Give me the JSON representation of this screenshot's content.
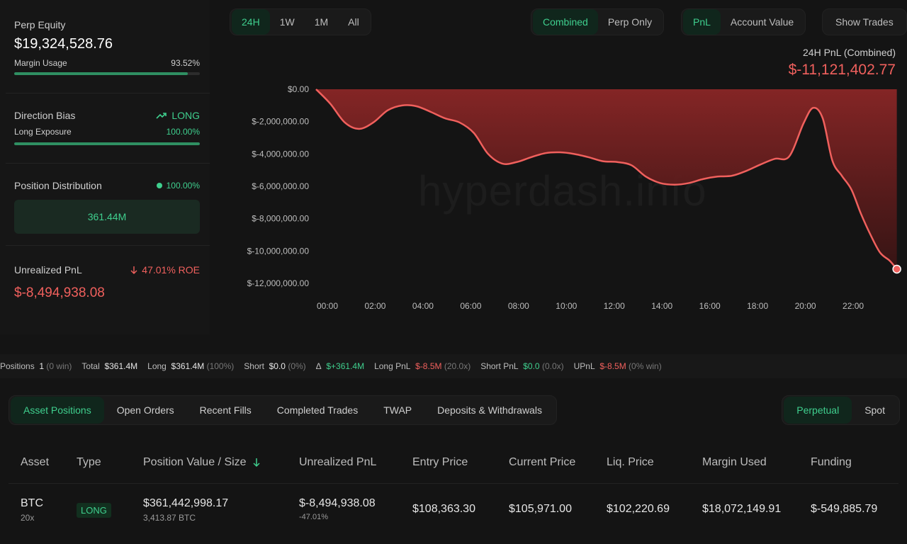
{
  "summary": {
    "perp_equity_label": "Perp Equity",
    "perp_equity_value": "$19,324,528.76",
    "margin_usage_label": "Margin Usage",
    "margin_usage_value": "93.52%",
    "margin_usage_fraction": 0.9352,
    "direction_bias_label": "Direction Bias",
    "direction_bias_value": "LONG",
    "long_exposure_label": "Long Exposure",
    "long_exposure_value": "100.00%",
    "long_exposure_fraction": 1.0,
    "position_distribution_label": "Position Distribution",
    "position_distribution_pct": "100.00%",
    "position_distribution_value": "361.44M",
    "unrealized_pnl_label": "Unrealized PnL",
    "roe_value": "47.01% ROE",
    "unrealized_pnl_value": "$-8,494,938.08"
  },
  "timeframes": [
    "24H",
    "1W",
    "1M",
    "All"
  ],
  "active_timeframe": "24H",
  "mode_options": [
    "Combined",
    "Perp Only"
  ],
  "active_mode": "Combined",
  "metric_options": [
    "PnL",
    "Account Value"
  ],
  "active_metric": "PnL",
  "show_trades_label": "Show Trades",
  "chart_header": {
    "label": "24H PnL (Combined)",
    "value": "$-11,121,402.77"
  },
  "watermark": "hyperdash.info",
  "chart_data": {
    "type": "area",
    "title": "24H PnL (Combined)",
    "x_tick_labels": [
      "00:00",
      "02:00",
      "04:00",
      "06:00",
      "08:00",
      "10:00",
      "12:00",
      "14:00",
      "16:00",
      "18:00",
      "20:00",
      "22:00"
    ],
    "y_tick_labels": [
      "$0.00",
      "$-2,000,000.00",
      "$-4,000,000.00",
      "$-6,000,000.00",
      "$-8,000,000.00",
      "$-10,000,000.00",
      "$-12,000,000.00"
    ],
    "ylim": [
      -12000000,
      0
    ],
    "xlim": [
      0,
      24.4
    ],
    "color": "#f0605d",
    "series": [
      {
        "x": [
          0,
          0.6,
          1.2,
          1.8,
          2.4,
          3.0,
          3.6,
          4.2,
          4.8,
          5.4,
          6.0,
          6.6,
          7.2,
          7.8,
          8.4,
          9.0,
          9.6,
          10.2,
          10.8,
          11.4,
          12.0,
          12.6,
          13.2,
          13.8,
          14.4,
          15.0,
          15.6,
          16.2,
          16.8,
          17.4,
          18.0,
          18.6,
          19.2,
          19.8,
          20.4,
          20.8,
          21.2,
          21.6,
          22.0,
          22.4,
          22.8,
          23.2,
          23.6,
          24.0,
          24.3
        ],
        "y": [
          0,
          -900000,
          -2050000,
          -2450000,
          -2050000,
          -1300000,
          -1000000,
          -1050000,
          -1400000,
          -1800000,
          -2050000,
          -2700000,
          -4000000,
          -4600000,
          -4500000,
          -4200000,
          -3950000,
          -3900000,
          -4000000,
          -4200000,
          -4450000,
          -4500000,
          -4700000,
          -5400000,
          -5800000,
          -5900000,
          -5800000,
          -5550000,
          -5400000,
          -5350000,
          -5050000,
          -4650000,
          -4300000,
          -4150000,
          -2100000,
          -1150000,
          -1800000,
          -4400000,
          -5350000,
          -6200000,
          -7700000,
          -9000000,
          -10100000,
          -10600000,
          -11121402.77
        ]
      }
    ]
  },
  "stats": {
    "positions_label": "Positions",
    "positions_value": "1",
    "positions_note": "(0 win)",
    "total_label": "Total",
    "total_value": "$361.4M",
    "long_label": "Long",
    "long_value": "$361.4M",
    "long_note": "(100%)",
    "short_label": "Short",
    "short_value": "$0.0",
    "short_note": "(0%)",
    "delta_label": "Δ",
    "delta_value": "$+361.4M",
    "long_pnl_label": "Long PnL",
    "long_pnl_value": "$-8.5M",
    "long_pnl_note": "(20.0x)",
    "short_pnl_label": "Short PnL",
    "short_pnl_value": "$0.0",
    "short_pnl_note": "(0.0x)",
    "upnl_label": "UPnL",
    "upnl_value": "$-8.5M",
    "upnl_note": "(0% win)"
  },
  "tabs": [
    "Asset Positions",
    "Open Orders",
    "Recent Fills",
    "Completed Trades",
    "TWAP",
    "Deposits & Withdrawals"
  ],
  "active_tab": "Asset Positions",
  "market_options": [
    "Perpetual",
    "Spot"
  ],
  "active_market": "Perpetual",
  "table": {
    "headers": [
      "Asset",
      "Type",
      "Position Value / Size",
      "Unrealized PnL",
      "Entry Price",
      "Current Price",
      "Liq. Price",
      "Margin Used",
      "Funding"
    ],
    "row": {
      "asset": "BTC",
      "leverage": "20x",
      "type": "LONG",
      "position_value": "$361,442,998.17",
      "position_size": "3,413.87 BTC",
      "unrealized_pnl": "$-8,494,938.08",
      "unrealized_pnl_pct": "-47.01%",
      "entry_price": "$108,363.30",
      "current_price": "$105,971.00",
      "liq_price": "$102,220.69",
      "margin_used": "$18,072,149.91",
      "funding": "$-549,885.79"
    }
  }
}
